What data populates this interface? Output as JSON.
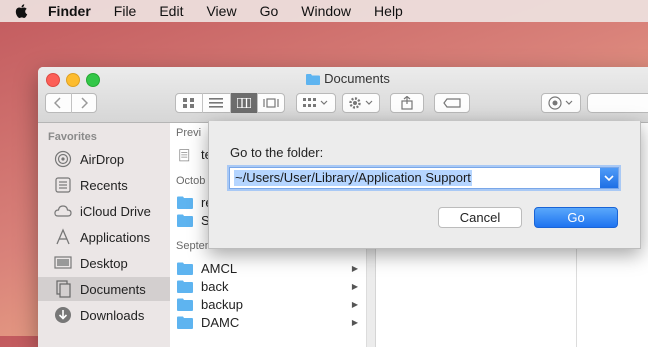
{
  "menubar": {
    "items": [
      "Finder",
      "File",
      "Edit",
      "View",
      "Go",
      "Window",
      "Help"
    ]
  },
  "window": {
    "title": "Documents"
  },
  "sidebar": {
    "header": "Favorites",
    "items": [
      {
        "label": "AirDrop",
        "icon": "airdrop-icon"
      },
      {
        "label": "Recents",
        "icon": "recents-icon"
      },
      {
        "label": "iCloud Drive",
        "icon": "cloud-icon"
      },
      {
        "label": "Applications",
        "icon": "applications-icon"
      },
      {
        "label": "Desktop",
        "icon": "desktop-icon"
      },
      {
        "label": "Documents",
        "icon": "documents-icon",
        "selected": true
      },
      {
        "label": "Downloads",
        "icon": "downloads-icon"
      }
    ]
  },
  "column": {
    "sections": [
      {
        "header": "Previ",
        "items": [
          {
            "name": "te",
            "kind": "file"
          }
        ]
      },
      {
        "header": "Octob",
        "items": [
          {
            "name": "re",
            "kind": "folder"
          },
          {
            "name": "Sl",
            "kind": "folder"
          }
        ]
      },
      {
        "header": "September",
        "items": [
          {
            "name": "AMCL",
            "kind": "folder"
          },
          {
            "name": "back",
            "kind": "folder"
          },
          {
            "name": "backup",
            "kind": "folder"
          },
          {
            "name": "DAMC",
            "kind": "folder"
          }
        ]
      }
    ]
  },
  "dialog": {
    "label": "Go to the folder:",
    "value": "~/Users/User/Library/Application Support",
    "cancel_label": "Cancel",
    "go_label": "Go"
  },
  "colors": {
    "accent": "#1e73f0",
    "folder": "#5eb4f0",
    "selection": "#b5d5ff"
  }
}
